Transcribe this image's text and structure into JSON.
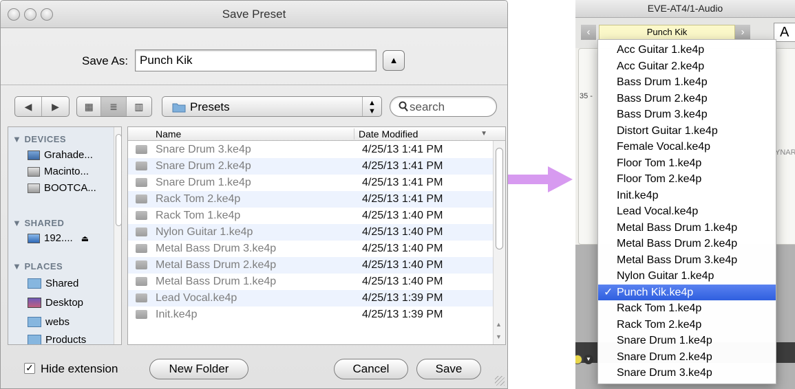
{
  "dialog": {
    "title": "Save Preset",
    "save_as_label": "Save As:",
    "save_as_value": "Punch Kik",
    "location": "Presets",
    "search_placeholder": "search",
    "sidebar": {
      "devices_header": "▼ DEVICES",
      "devices": [
        "Grahade...",
        "Macinto...",
        "BOOTCA..."
      ],
      "shared_header": "▼ SHARED",
      "shared": [
        "192...."
      ],
      "places_header": "▼ PLACES",
      "places": [
        "Shared",
        "Desktop",
        "webs",
        "Products"
      ]
    },
    "columns": {
      "name": "Name",
      "date": "Date Modified"
    },
    "files": [
      {
        "name": "Snare Drum 3.ke4p",
        "date": "4/25/13 1:41 PM"
      },
      {
        "name": "Snare Drum 2.ke4p",
        "date": "4/25/13 1:41 PM"
      },
      {
        "name": "Snare Drum 1.ke4p",
        "date": "4/25/13 1:41 PM"
      },
      {
        "name": "Rack Tom 2.ke4p",
        "date": "4/25/13 1:41 PM"
      },
      {
        "name": "Rack Tom 1.ke4p",
        "date": "4/25/13 1:40 PM"
      },
      {
        "name": "Nylon Guitar 1.ke4p",
        "date": "4/25/13 1:40 PM"
      },
      {
        "name": "Metal Bass Drum 3.ke4p",
        "date": "4/25/13 1:40 PM"
      },
      {
        "name": "Metal Bass Drum 2.ke4p",
        "date": "4/25/13 1:40 PM"
      },
      {
        "name": "Metal Bass Drum 1.ke4p",
        "date": "4/25/13 1:40 PM"
      },
      {
        "name": "Lead Vocal.ke4p",
        "date": "4/25/13 1:39 PM"
      },
      {
        "name": "Init.ke4p",
        "date": "4/25/13 1:39 PM"
      }
    ],
    "hide_extension_label": "Hide extension",
    "hide_extension_checked": true,
    "new_folder_label": "New Folder",
    "cancel_label": "Cancel",
    "save_label": "Save"
  },
  "plugin": {
    "title": "EVE-AT4/1-Audio",
    "preset_name": "Punch Kik",
    "a_label": "A",
    "side_number": "35 -",
    "side_text": "YNAR",
    "menu_items": [
      "Acc Guitar 1.ke4p",
      "Acc Guitar 2.ke4p",
      "Bass Drum 1.ke4p",
      "Bass Drum 2.ke4p",
      "Bass Drum 3.ke4p",
      "Distort Guitar 1.ke4p",
      "Female Vocal.ke4p",
      "Floor Tom 1.ke4p",
      "Floor Tom 2.ke4p",
      "Init.ke4p",
      "Lead Vocal.ke4p",
      "Metal Bass Drum 1.ke4p",
      "Metal Bass Drum 2.ke4p",
      "Metal Bass Drum 3.ke4p",
      "Nylon Guitar 1.ke4p",
      "Punch Kik.ke4p",
      "Rack Tom 1.ke4p",
      "Rack Tom 2.ke4p",
      "Snare Drum 1.ke4p",
      "Snare Drum 2.ke4p",
      "Snare Drum 3.ke4p"
    ],
    "selected_item": "Punch Kik.ke4p",
    "check_glyph": "✓"
  },
  "colors": {
    "arrow": "#d79af0",
    "menu_highlight": "#3a68e6",
    "preset_field": "#fbf8c9"
  },
  "icons": [
    "folder-icon",
    "search-icon",
    "eject-icon",
    "drive-icon",
    "network-icon",
    "desktop-icon"
  ]
}
